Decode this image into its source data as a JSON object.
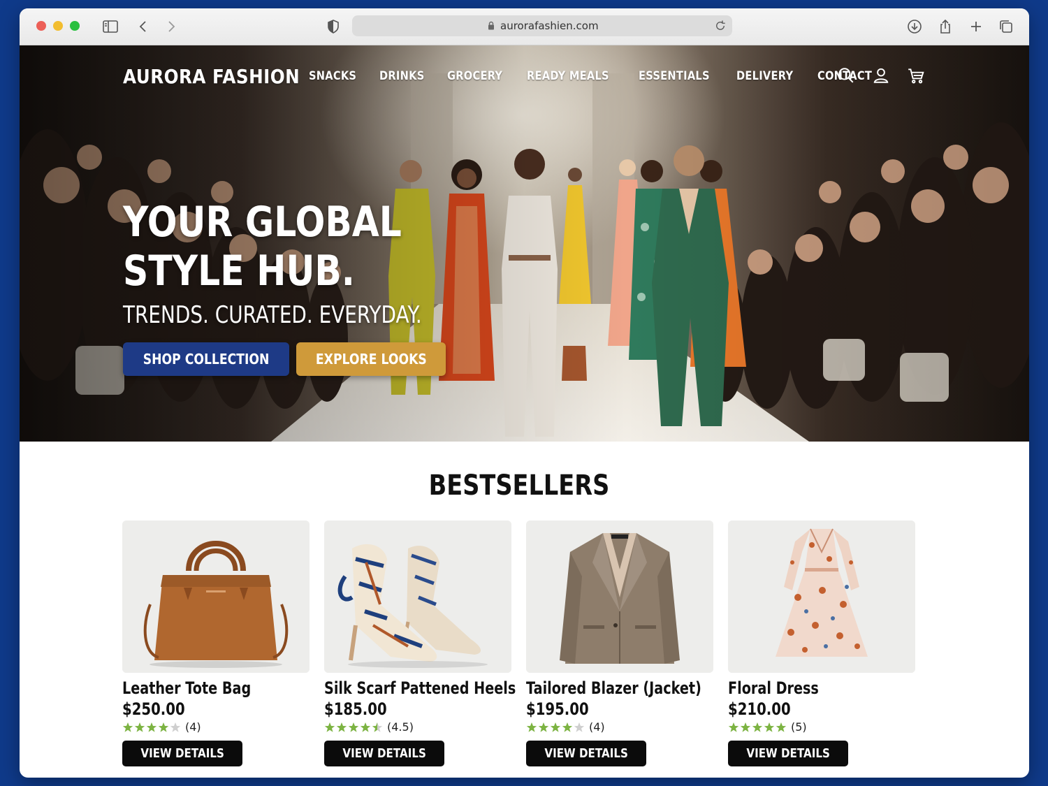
{
  "browser": {
    "url": "aurorafashien.com"
  },
  "site": {
    "brand": "AURORA FASHION",
    "nav": [
      "SNACKS",
      "DRINKS",
      "GROCERY",
      "READY MEALS",
      "ESSENTIALS",
      "DELIVERY",
      "CONTACT"
    ],
    "icons": [
      "search-icon",
      "account-icon",
      "cart-icon"
    ]
  },
  "hero": {
    "title_line1": "YOUR GLOBAL",
    "title_line2": "STYLE HUB.",
    "subtitle": "TRENDS. CURATED. EVERYDAY.",
    "primary_button": "SHOP COLLECTION",
    "secondary_button": "EXPLORE LOOKS"
  },
  "colors": {
    "primary_button": "#1e3a86",
    "secondary_button": "#cf9a3a",
    "star": "#7cb342",
    "page_background": "#0f3a8a"
  },
  "bestsellers": {
    "title": "BESTSELLERS",
    "products": [
      {
        "name": "Leather Tote Bag",
        "price": "$250.00",
        "rating": 4,
        "rating_label": "(4)",
        "button": "VIEW DETAILS",
        "image": "leather-tote-bag"
      },
      {
        "name": "Silk Scarf Pattened Heels",
        "price": "$185.00",
        "rating": 4.5,
        "rating_label": "(4.5)",
        "button": "VIEW DETAILS",
        "image": "silk-scarf-heels"
      },
      {
        "name": "Tailored Blazer (Jacket)",
        "price": "$195.00",
        "rating": 4,
        "rating_label": "(4)",
        "button": "VIEW DETAILS",
        "image": "tailored-blazer"
      },
      {
        "name": "Floral Dress",
        "price": "$210.00",
        "rating": 5,
        "rating_label": "(5)",
        "button": "VIEW DETAILS",
        "image": "floral-dress"
      }
    ]
  }
}
